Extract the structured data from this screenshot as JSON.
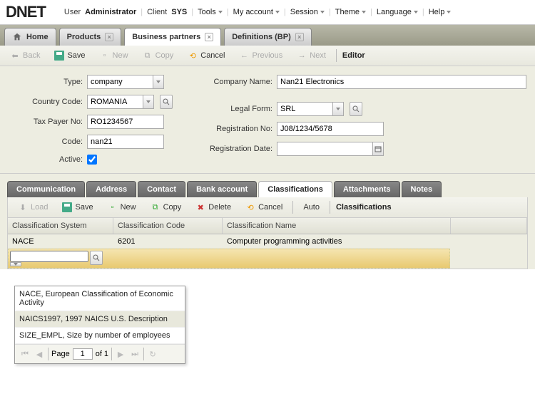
{
  "topbar": {
    "user_label": "User",
    "user_value": "Administrator",
    "client_label": "Client",
    "client_value": "SYS",
    "menus": [
      "Tools",
      "My account",
      "Session",
      "Theme",
      "Language",
      "Help"
    ]
  },
  "main_tabs": [
    {
      "label": "Home",
      "closable": false,
      "icon": "home"
    },
    {
      "label": "Products",
      "closable": true
    },
    {
      "label": "Business partners",
      "closable": true,
      "active": true
    },
    {
      "label": "Definitions (BP)",
      "closable": true
    }
  ],
  "toolbar": {
    "back": "Back",
    "save": "Save",
    "new": "New",
    "copy": "Copy",
    "cancel": "Cancel",
    "previous": "Previous",
    "next": "Next",
    "editor": "Editor"
  },
  "form": {
    "type_label": "Type:",
    "type_value": "company",
    "country_label": "Country Code:",
    "country_value": "ROMANIA",
    "tax_label": "Tax Payer No:",
    "tax_value": "RO1234567",
    "code_label": "Code:",
    "code_value": "nan21",
    "active_label": "Active:",
    "active_checked": true,
    "company_name_label": "Company Name:",
    "company_name_value": "Nan21 Electronics",
    "legal_form_label": "Legal Form:",
    "legal_form_value": "SRL",
    "reg_no_label": "Registration No:",
    "reg_no_value": "J08/1234/5678",
    "reg_date_label": "Registration Date:",
    "reg_date_value": ""
  },
  "subtabs": [
    "Communication",
    "Address",
    "Contact",
    "Bank account",
    "Classifications",
    "Attachments",
    "Notes"
  ],
  "subtab_active": "Classifications",
  "grid_toolbar": {
    "load": "Load",
    "save": "Save",
    "new": "New",
    "copy": "Copy",
    "delete": "Delete",
    "cancel": "Cancel",
    "auto": "Auto",
    "title": "Classifications"
  },
  "grid": {
    "headers": [
      "Classification System",
      "Classification Code",
      "Classification Name",
      ""
    ],
    "rows": [
      {
        "system": "NACE",
        "code": "6201",
        "name": "Computer programming activities"
      }
    ],
    "editing_value": ""
  },
  "dropdown_options": [
    "NACE, European Classification of Economic Activity",
    "NAICS1997, 1997 NAICS U.S. Description",
    "SIZE_EMPL, Size by number of employees"
  ],
  "dropdown_hover_index": 1,
  "pager": {
    "page_label": "Page",
    "page_value": "1",
    "of_label": "of 1"
  }
}
